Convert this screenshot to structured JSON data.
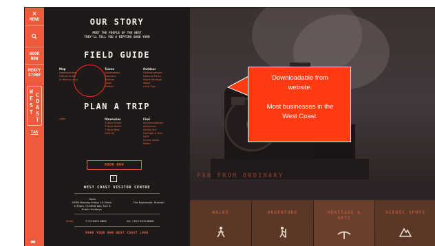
{
  "nav": {
    "menu_label": "MENU",
    "menu_icon": "close-icon",
    "search_icon": "search-icon",
    "book_label_1": "BOOK",
    "book_label_2": "NOW",
    "mercy_label_1": "MERCY",
    "mercy_label_2": "STORE",
    "logo_letters": [
      "W",
      "E",
      "S",
      "T",
      "C",
      "O",
      "A",
      "S",
      "T"
    ],
    "tas_label": "TAS"
  },
  "panel": {
    "our_story_title": "OUR STORY",
    "our_story_sub_1": "MEET THE PEOPLE OF THE WEST",
    "our_story_sub_2": "THEY'LL TELL YOU A RIPPING GOOD YARN",
    "field_guide_title": "FIELD GUIDE",
    "field_guide_cols": [
      {
        "title": "Map",
        "items": [
          "Download the",
          "Official Guide",
          "to Rolling Land"
        ]
      },
      {
        "title": "Towns",
        "items": [
          "Queenstown",
          "Rosebery",
          "Strahan",
          "Tullah",
          "Zeehan"
        ]
      },
      {
        "title": "Outdoor",
        "items": [
          "Getting Around",
          "National Parks",
          "World Heritage",
          "Walks",
          "Local Tips"
        ]
      }
    ],
    "plan_title": "PLAN A TRIP",
    "plan_cols": [
      {
        "title": "Login",
        "items": []
      },
      {
        "title": "Itineraries",
        "items": [
          "3 Days Grand",
          "3 Days Better",
          "7 Days Best",
          "View all"
        ]
      },
      {
        "title": "Find",
        "items": [
          "Accommodation",
          "Adventure",
          "Eating Out",
          "Heritage & Arts",
          "NITR",
          "Scenic Spots",
          "Walks"
        ]
      }
    ],
    "book_button": "BOOK NOW",
    "info_badge": "i",
    "visitor_centre_title": "WEST COAST VISITOR CENTRE",
    "open_label": "Open",
    "hours_1": "OPEN Monday-Friday 10.30am-",
    "hours_2": "4.30pm. CLOSED Sat, Sun &",
    "hours_3": "Public Holidays.",
    "address": "The Esplanade, Strahan",
    "email_label": "Email",
    "phone_1": "T: 03 6472 6800",
    "phone_2": "Int. +613 6472 6800",
    "own_logo": "MAKE YOUR OWN WEST COAST LOGO"
  },
  "photo": {
    "overlay_text": "FAR FROM ORDINARY",
    "tiles": [
      {
        "label_1": "WALKS",
        "label_2": "",
        "icon": "walker-icon"
      },
      {
        "label_1": "ADVENTURE",
        "label_2": "",
        "icon": "hiker-icon"
      },
      {
        "label_1": "HERITAGE &",
        "label_2": "ARTS",
        "icon": "pickaxe-icon"
      },
      {
        "label_1": "SCENIC SPOTS",
        "label_2": "",
        "icon": "mountain-icon"
      }
    ]
  },
  "callout": {
    "line_1": "Downloadable from",
    "line_2": "website.",
    "line_3": "Most businesses in the",
    "line_4": "West Coast."
  },
  "colors": {
    "accent": "#ee5b3c",
    "callout": "#ff3b12",
    "panel": "#1d1a19"
  }
}
